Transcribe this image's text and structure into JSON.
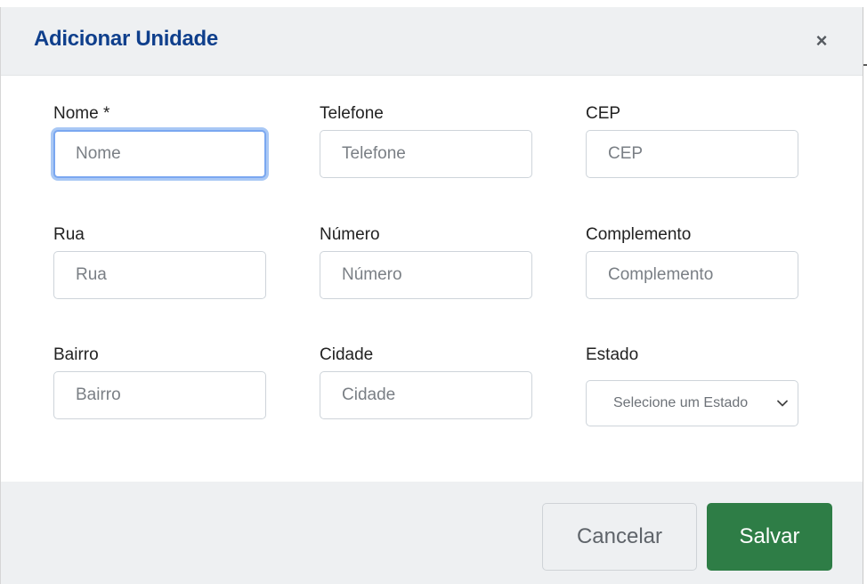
{
  "modal": {
    "title": "Adicionar Unidade",
    "close_glyph": "×"
  },
  "fields": {
    "nome": {
      "label": "Nome *",
      "placeholder": "Nome",
      "value": ""
    },
    "telefone": {
      "label": "Telefone",
      "placeholder": "Telefone",
      "value": ""
    },
    "cep": {
      "label": "CEP",
      "placeholder": "CEP",
      "value": ""
    },
    "rua": {
      "label": "Rua",
      "placeholder": "Rua",
      "value": ""
    },
    "numero": {
      "label": "Número",
      "placeholder": "Número",
      "value": ""
    },
    "complemento": {
      "label": "Complemento",
      "placeholder": "Complemento",
      "value": ""
    },
    "bairro": {
      "label": "Bairro",
      "placeholder": "Bairro",
      "value": ""
    },
    "cidade": {
      "label": "Cidade",
      "placeholder": "Cidade",
      "value": ""
    },
    "estado": {
      "label": "Estado",
      "selected_text": "Selecione um Estado"
    }
  },
  "footer": {
    "cancel_label": "Cancelar",
    "save_label": "Salvar"
  },
  "colors": {
    "title": "#0f3f8c",
    "save_button": "#2e7d46",
    "header_bg": "#eef0f2",
    "focus_ring": "#7aa7f0"
  },
  "icons": {
    "close": "close-icon",
    "select": "chevron-down-icon"
  }
}
